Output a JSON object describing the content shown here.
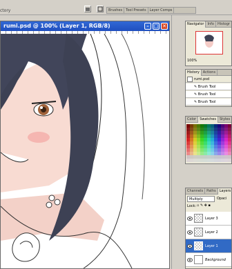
{
  "app": {
    "top_label": "ctory"
  },
  "palette_well": {
    "tabs": [
      "Brushes",
      "Tool Presets",
      "Layer Comps"
    ]
  },
  "document": {
    "title": "rumi.psd @ 100% (Layer 1, RGB/8)"
  },
  "navigator": {
    "tabs": [
      "Navigator",
      "Info",
      "Histogr"
    ],
    "zoom": "100%"
  },
  "history": {
    "tabs": [
      "History",
      "Actions"
    ],
    "snapshot": "rumi.psd",
    "items": [
      "Brush Tool",
      "Brush Tool",
      "Brush Tool"
    ]
  },
  "color": {
    "tabs": [
      "Color",
      "Swatches",
      "Styles"
    ]
  },
  "layers": {
    "tabs": [
      "Channels",
      "Paths",
      "Layers"
    ],
    "blend_mode": "Multiply",
    "opacity_label": "Opaci",
    "lock_label": "Lock:",
    "items": [
      {
        "name": "Layer 3",
        "selected": false
      },
      {
        "name": "Layer 2",
        "selected": false
      },
      {
        "name": "Layer 1",
        "selected": true
      },
      {
        "name": "Background",
        "selected": false
      }
    ]
  },
  "colors": {
    "accent": "#316ac5",
    "title": "#2a5bd0",
    "hair": "#3f4354",
    "skin": "#f7d9cf"
  }
}
